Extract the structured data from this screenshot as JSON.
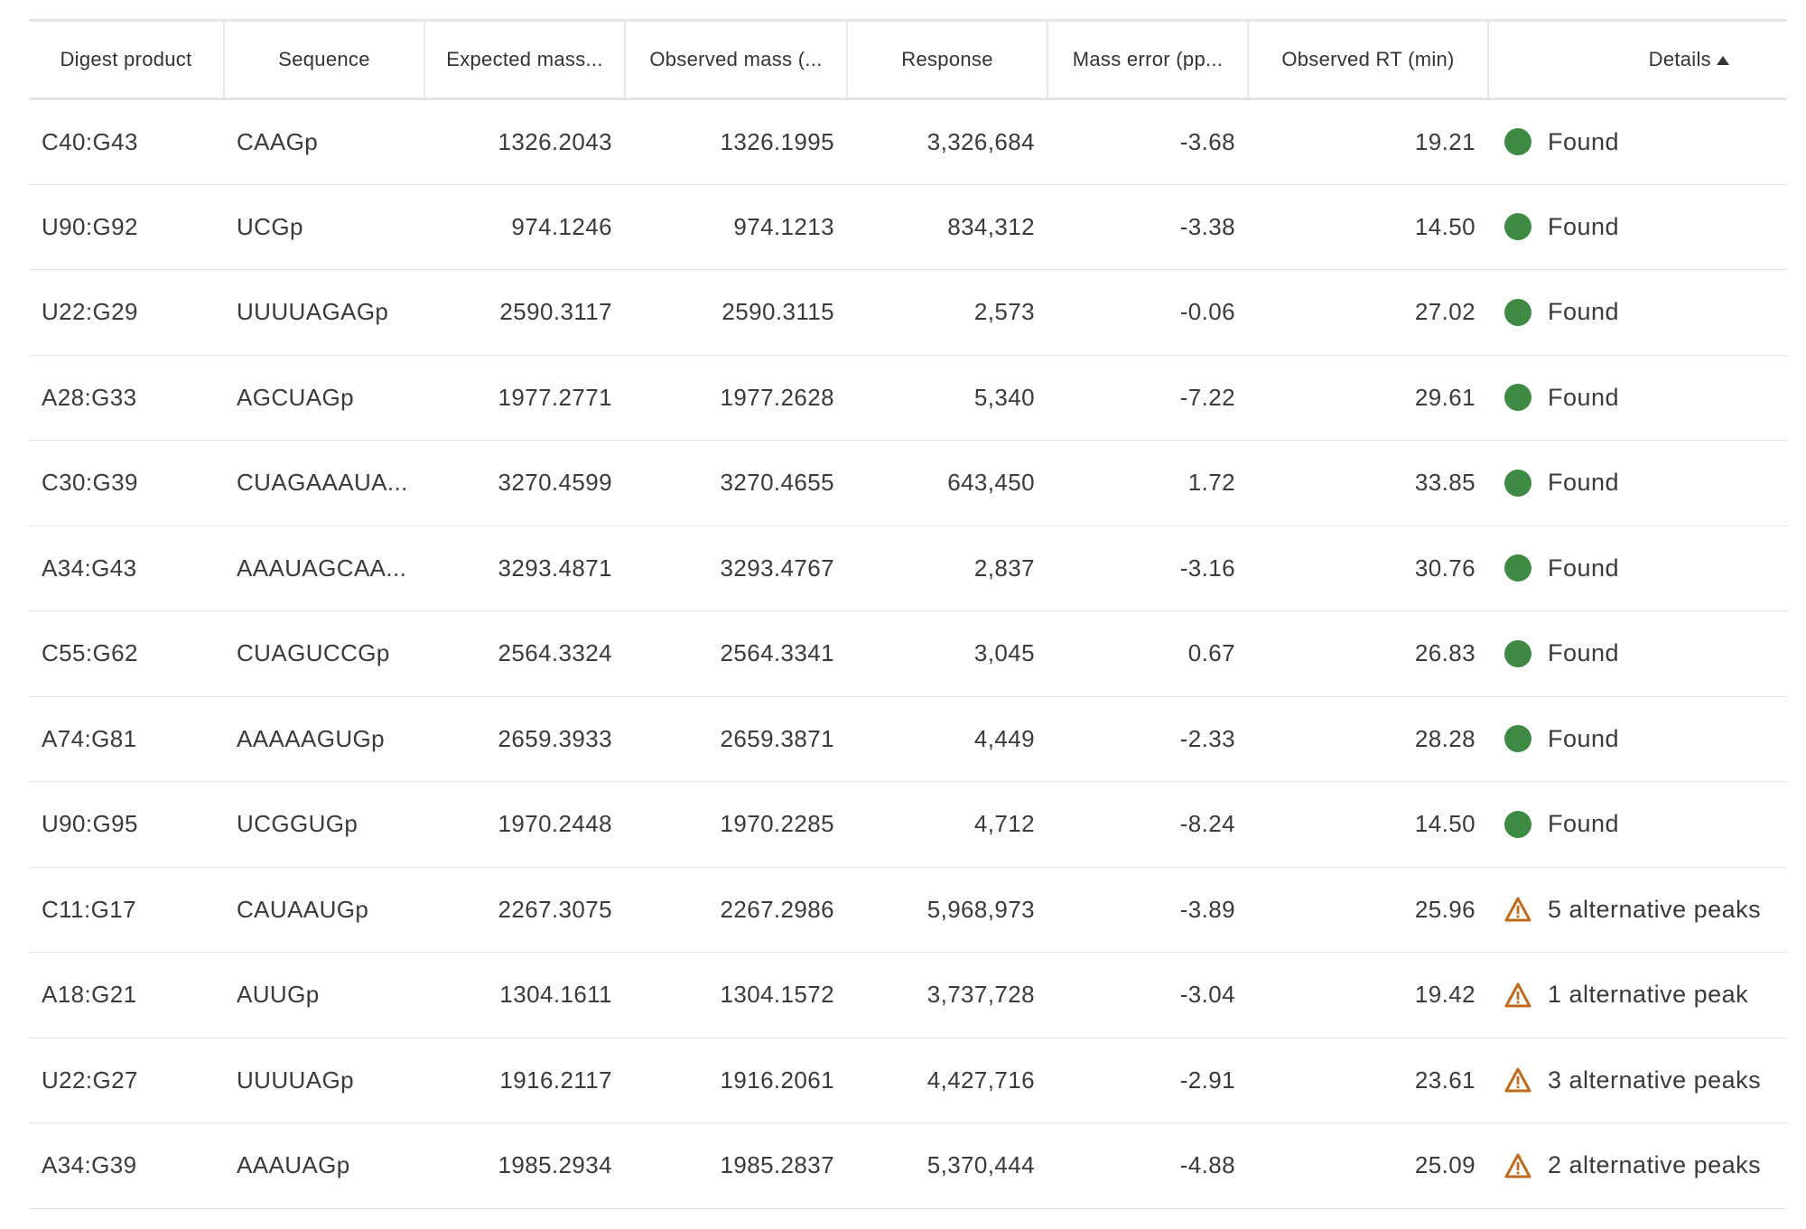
{
  "colors": {
    "found": "#3e8a45",
    "warning": "#c06a1e",
    "text": "#333333",
    "grid": "#e4e4e4"
  },
  "table": {
    "columns": [
      "Digest product",
      "Sequence",
      "Expected mass...",
      "Observed mass (...",
      "Response",
      "Mass error (pp...",
      "Observed RT (min)",
      "Details"
    ],
    "sort": {
      "column": "Details",
      "direction": "ascending",
      "icon": "sort-ascending-icon"
    },
    "rows": [
      {
        "product": "C40:G43",
        "sequence": "CAAGp",
        "expected": "1326.2043",
        "observed": "1326.1995",
        "response": "3,326,684",
        "error": "-3.68",
        "rt": "19.21",
        "status": "found",
        "status_icon": "green-dot-icon",
        "details": "Found"
      },
      {
        "product": "U90:G92",
        "sequence": "UCGp",
        "expected": "974.1246",
        "observed": "974.1213",
        "response": "834,312",
        "error": "-3.38",
        "rt": "14.50",
        "status": "found",
        "status_icon": "green-dot-icon",
        "details": "Found"
      },
      {
        "product": "U22:G29",
        "sequence": "UUUUAGAGp",
        "expected": "2590.3117",
        "observed": "2590.3115",
        "response": "2,573",
        "error": "-0.06",
        "rt": "27.02",
        "status": "found",
        "status_icon": "green-dot-icon",
        "details": "Found"
      },
      {
        "product": "A28:G33",
        "sequence": "AGCUAGp",
        "expected": "1977.2771",
        "observed": "1977.2628",
        "response": "5,340",
        "error": "-7.22",
        "rt": "29.61",
        "status": "found",
        "status_icon": "green-dot-icon",
        "details": "Found"
      },
      {
        "product": "C30:G39",
        "sequence": "CUAGAAAUA...",
        "expected": "3270.4599",
        "observed": "3270.4655",
        "response": "643,450",
        "error": "1.72",
        "rt": "33.85",
        "status": "found",
        "status_icon": "green-dot-icon",
        "details": "Found"
      },
      {
        "product": "A34:G43",
        "sequence": "AAAUAGCAA...",
        "expected": "3293.4871",
        "observed": "3293.4767",
        "response": "2,837",
        "error": "-3.16",
        "rt": "30.76",
        "status": "found",
        "status_icon": "green-dot-icon",
        "details": "Found"
      },
      {
        "product": "C55:G62",
        "sequence": "CUAGUCCGp",
        "expected": "2564.3324",
        "observed": "2564.3341",
        "response": "3,045",
        "error": "0.67",
        "rt": "26.83",
        "status": "found",
        "status_icon": "green-dot-icon",
        "details": "Found"
      },
      {
        "product": "A74:G81",
        "sequence": "AAAAAGUGp",
        "expected": "2659.3933",
        "observed": "2659.3871",
        "response": "4,449",
        "error": "-2.33",
        "rt": "28.28",
        "status": "found",
        "status_icon": "green-dot-icon",
        "details": "Found"
      },
      {
        "product": "U90:G95",
        "sequence": "UCGGUGp",
        "expected": "1970.2448",
        "observed": "1970.2285",
        "response": "4,712",
        "error": "-8.24",
        "rt": "14.50",
        "status": "found",
        "status_icon": "green-dot-icon",
        "details": "Found"
      },
      {
        "product": "C11:G17",
        "sequence": "CAUAAUGp",
        "expected": "2267.3075",
        "observed": "2267.2986",
        "response": "5,968,973",
        "error": "-3.89",
        "rt": "25.96",
        "status": "warning",
        "status_icon": "warning-triangle-icon",
        "details": "5 alternative peaks"
      },
      {
        "product": "A18:G21",
        "sequence": "AUUGp",
        "expected": "1304.1611",
        "observed": "1304.1572",
        "response": "3,737,728",
        "error": "-3.04",
        "rt": "19.42",
        "status": "warning",
        "status_icon": "warning-triangle-icon",
        "details": "1 alternative peak"
      },
      {
        "product": "U22:G27",
        "sequence": "UUUUAGp",
        "expected": "1916.2117",
        "observed": "1916.2061",
        "response": "4,427,716",
        "error": "-2.91",
        "rt": "23.61",
        "status": "warning",
        "status_icon": "warning-triangle-icon",
        "details": "3 alternative peaks"
      },
      {
        "product": "A34:G39",
        "sequence": "AAAUAGp",
        "expected": "1985.2934",
        "observed": "1985.2837",
        "response": "5,370,444",
        "error": "-4.88",
        "rt": "25.09",
        "status": "warning",
        "status_icon": "warning-triangle-icon",
        "details": "2 alternative peaks"
      }
    ]
  }
}
